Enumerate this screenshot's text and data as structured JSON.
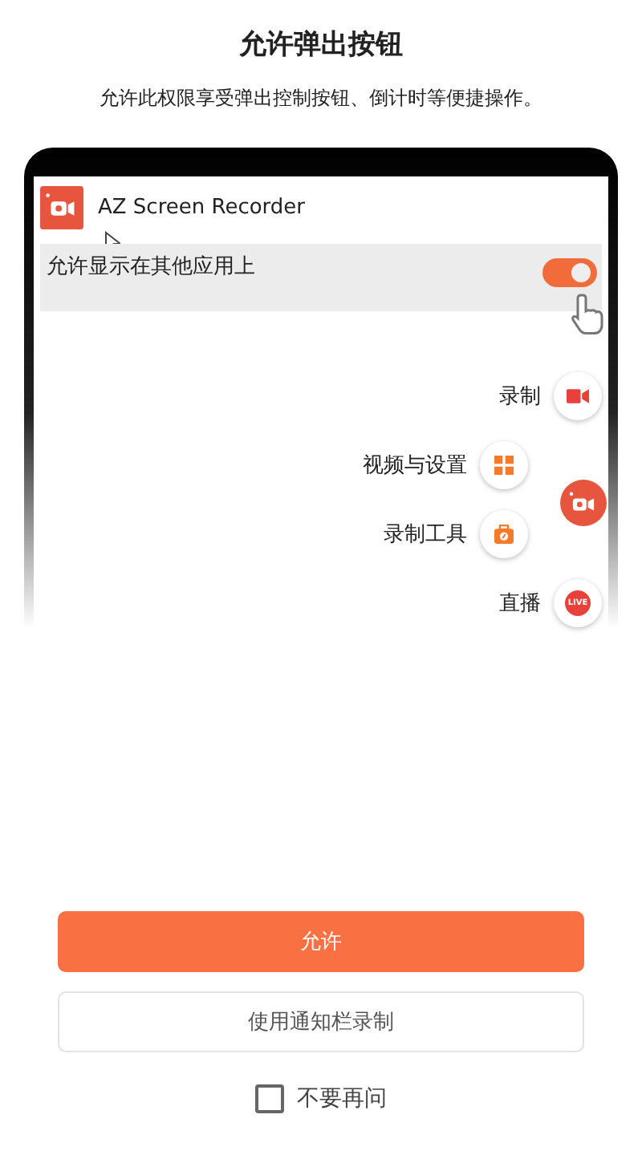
{
  "title": "允许弹出按钮",
  "subtitle": "允许此权限享受弹出控制按钮、倒计时等便捷操作。",
  "phone": {
    "app_name": "AZ Screen Recorder",
    "setting": {
      "label": "允许显示在其他应用上",
      "on": true
    },
    "menu": [
      {
        "label": "录制",
        "kind": "record"
      },
      {
        "label": "视频与设置",
        "kind": "grid"
      },
      {
        "label": "录制工具",
        "kind": "tools"
      },
      {
        "label": "直播",
        "kind": "live",
        "icon_text": "LIVE"
      }
    ]
  },
  "primary_button": "允许",
  "secondary_button": "使用通知栏录制",
  "dont_ask": {
    "label": "不要再问",
    "checked": false
  }
}
